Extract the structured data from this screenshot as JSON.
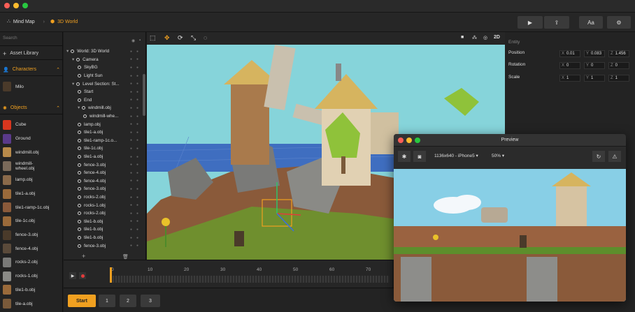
{
  "breadcrumb": {
    "root": "Mind Map",
    "current": "3D World"
  },
  "toolbar": {
    "play_icon": "▶",
    "export_icon": "⇪",
    "font_label": "Aa",
    "settings_icon": "⚙"
  },
  "left_panel": {
    "search_placeholder": "Search",
    "asset_library": "Asset Library",
    "characters_title": "Characters",
    "characters": [
      {
        "label": "Milo"
      }
    ],
    "objects_title": "Objects",
    "objects": [
      {
        "label": "Cube"
      },
      {
        "label": "Ground"
      },
      {
        "label": "windmill.obj"
      },
      {
        "label": "windmill-\nwheel.obj"
      },
      {
        "label": "lamp.obj"
      },
      {
        "label": "tile1-a.obj"
      },
      {
        "label": "tile1-ramp-1c.obj"
      },
      {
        "label": "tile-1c.obj"
      },
      {
        "label": "fence-3.obj"
      },
      {
        "label": "fence-4.obj"
      },
      {
        "label": "rocks-2.obj"
      },
      {
        "label": "rocks-1.obj"
      },
      {
        "label": "tile1-b.obj"
      },
      {
        "label": "tile-a.obj"
      }
    ]
  },
  "hierarchy": {
    "items": [
      {
        "label": "World: 3D World"
      },
      {
        "label": "Camera"
      },
      {
        "label": "SkyBG"
      },
      {
        "label": "Light Sun"
      },
      {
        "label": "Level Section: St..."
      },
      {
        "label": "Start"
      },
      {
        "label": "End"
      },
      {
        "label": "windmill.obj"
      },
      {
        "label": "windmill-whe..."
      },
      {
        "label": "lamp.obj"
      },
      {
        "label": "tile1-a.obj"
      },
      {
        "label": "tile1-ramp-1c.o..."
      },
      {
        "label": "tile-1c.obj"
      },
      {
        "label": "tile1-a.obj"
      },
      {
        "label": "fence-3.obj"
      },
      {
        "label": "fence-4.obj"
      },
      {
        "label": "fence-4.obj"
      },
      {
        "label": "fence-3.obj"
      },
      {
        "label": "rocks-2.obj"
      },
      {
        "label": "rocks-1.obj"
      },
      {
        "label": "rocks-2.obj"
      },
      {
        "label": "tile1-b.obj"
      },
      {
        "label": "tile1-b.obj"
      },
      {
        "label": "tile1-b.obj"
      },
      {
        "label": "fence-3.obj"
      }
    ]
  },
  "viewport": {
    "mode_2d": "2D"
  },
  "inspector": {
    "title": "Entity",
    "position": {
      "label": "Position",
      "x": "0.01",
      "y": "0.083",
      "z": "1.456"
    },
    "rotation": {
      "label": "Rotation",
      "x": "0",
      "y": "0",
      "z": "0"
    },
    "scale": {
      "label": "Scale",
      "x": "1",
      "y": "1",
      "z": "1"
    },
    "axis_x": "X",
    "axis_y": "Y",
    "axis_z": "Z"
  },
  "timeline": {
    "ticks": [
      "0",
      "10",
      "20",
      "30",
      "40",
      "50",
      "60",
      "70"
    ]
  },
  "sections": {
    "start": "Start",
    "s1": "1",
    "s2": "2",
    "s3": "3"
  },
  "preview": {
    "title": "Preview",
    "device": "1136x640 - iPhone5 ▾",
    "zoom": "50% ▾"
  },
  "colors": {
    "accent": "#f0a020"
  }
}
